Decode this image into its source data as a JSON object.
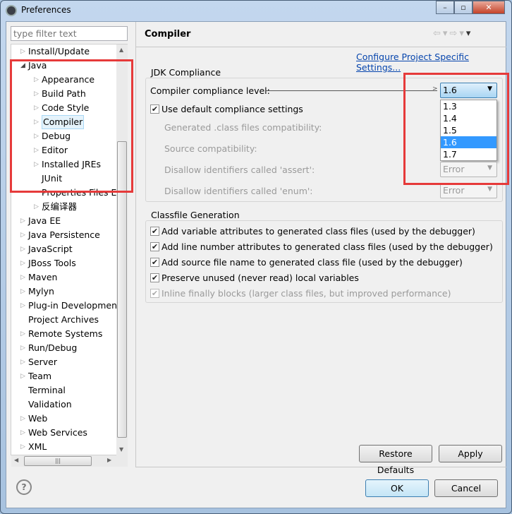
{
  "window": {
    "title": "Preferences"
  },
  "filter": {
    "placeholder": "type filter text"
  },
  "tree": [
    {
      "label": "Install/Update",
      "level": 0,
      "expander": "collapsed"
    },
    {
      "label": "Java",
      "level": 0,
      "expander": "expanded"
    },
    {
      "label": "Appearance",
      "level": 1,
      "expander": "collapsed"
    },
    {
      "label": "Build Path",
      "level": 1,
      "expander": "collapsed"
    },
    {
      "label": "Code Style",
      "level": 1,
      "expander": "collapsed"
    },
    {
      "label": "Compiler",
      "level": 1,
      "expander": "collapsed",
      "selected": true
    },
    {
      "label": "Debug",
      "level": 1,
      "expander": "collapsed"
    },
    {
      "label": "Editor",
      "level": 1,
      "expander": "collapsed"
    },
    {
      "label": "Installed JREs",
      "level": 1,
      "expander": "collapsed"
    },
    {
      "label": "JUnit",
      "level": 1,
      "expander": "none"
    },
    {
      "label": "Properties Files Ec",
      "level": 1,
      "expander": "none"
    },
    {
      "label": "反编译器",
      "level": 1,
      "expander": "collapsed"
    },
    {
      "label": "Java EE",
      "level": 0,
      "expander": "collapsed"
    },
    {
      "label": "Java Persistence",
      "level": 0,
      "expander": "collapsed"
    },
    {
      "label": "JavaScript",
      "level": 0,
      "expander": "collapsed"
    },
    {
      "label": "JBoss Tools",
      "level": 0,
      "expander": "collapsed"
    },
    {
      "label": "Maven",
      "level": 0,
      "expander": "collapsed"
    },
    {
      "label": "Mylyn",
      "level": 0,
      "expander": "collapsed"
    },
    {
      "label": "Plug-in Development",
      "level": 0,
      "expander": "collapsed"
    },
    {
      "label": "Project Archives",
      "level": 0,
      "expander": "none"
    },
    {
      "label": "Remote Systems",
      "level": 0,
      "expander": "collapsed"
    },
    {
      "label": "Run/Debug",
      "level": 0,
      "expander": "collapsed"
    },
    {
      "label": "Server",
      "level": 0,
      "expander": "collapsed"
    },
    {
      "label": "Team",
      "level": 0,
      "expander": "collapsed"
    },
    {
      "label": "Terminal",
      "level": 0,
      "expander": "none"
    },
    {
      "label": "Validation",
      "level": 0,
      "expander": "none"
    },
    {
      "label": "Web",
      "level": 0,
      "expander": "collapsed"
    },
    {
      "label": "Web Services",
      "level": 0,
      "expander": "collapsed"
    },
    {
      "label": "XML",
      "level": 0,
      "expander": "collapsed"
    }
  ],
  "page": {
    "title": "Compiler",
    "configure_link": "Configure Project Specific Settings...",
    "jdk": {
      "group": "JDK Compliance",
      "level_label": "Compiler compliance level:",
      "level_value": "1.6",
      "options": [
        "1.3",
        "1.4",
        "1.5",
        "1.6",
        "1.7"
      ],
      "use_default": "Use default compliance settings",
      "generated": "Generated .class files compatibility:",
      "source": "Source compatibility:",
      "assert": "Disallow identifiers called 'assert':",
      "assert_value": "Error",
      "enum": "Disallow identifiers called 'enum':",
      "enum_value": "Error"
    },
    "classfile": {
      "group": "Classfile Generation",
      "items": [
        "Add variable attributes to generated class files (used by the debugger)",
        "Add line number attributes to generated class files (used by the debugger)",
        "Add source file name to generated class file (used by the debugger)",
        "Preserve unused (never read) local variables",
        "Inline finally blocks (larger class files, but improved performance)"
      ]
    },
    "restore": "Restore Defaults",
    "apply": "Apply"
  },
  "footer": {
    "ok": "OK",
    "cancel": "Cancel"
  },
  "colors": {
    "highlight": "#e63a3a",
    "selection": "#3399ff",
    "link": "#0645ad"
  }
}
